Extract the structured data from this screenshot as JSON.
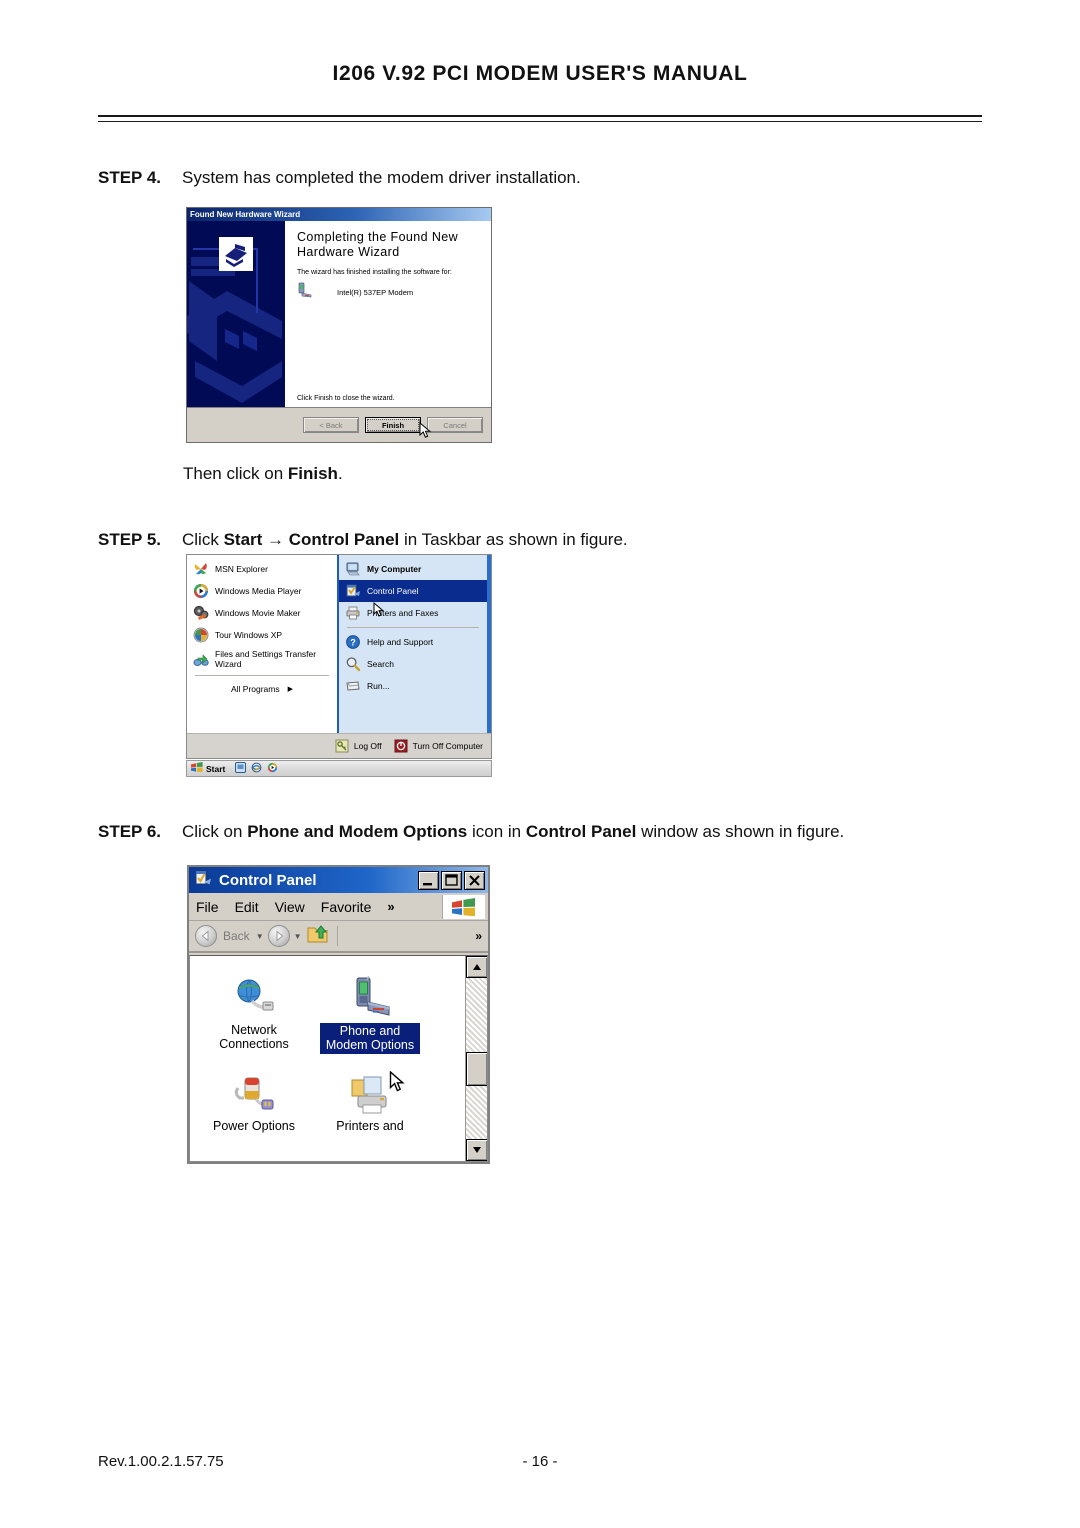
{
  "document": {
    "header_title": "I206 V.92 PCI MODEM USER'S MANUAL",
    "footer_revision": "Rev.1.00.2.1.57.75",
    "footer_page": "- 16 -"
  },
  "steps": {
    "step4": {
      "label": "STEP 4.",
      "text": "System has completed the modem driver installation."
    },
    "step4_note_prefix": "Then click on ",
    "step4_note_bold": "Finish",
    "step4_note_suffix": ".",
    "step5": {
      "label": "STEP 5.",
      "t1": "Click ",
      "b1": "Start",
      "t2": " ",
      "arrow": "→",
      "t3": " ",
      "b2": "Control Panel",
      "t4": " in Taskbar as shown in figure."
    },
    "step6": {
      "label": "STEP 6.",
      "t1": "Click on ",
      "b1": "Phone and Modem Options",
      "t2": " icon in ",
      "b2": "Control Panel",
      "t3": " window as shown in figure."
    }
  },
  "wizard": {
    "titlebar": "Found New Hardware Wizard",
    "heading_line1": "Completing the Found New",
    "heading_line2": "Hardware Wizard",
    "subtext": "The wizard has finished installing the software for:",
    "device_name": "Intel(R) 537EP Modem",
    "device_icon": "modem-icon",
    "sidebar_icon": "wizard-emblem-icon",
    "footer_text": "Click Finish to close the wizard.",
    "buttons": {
      "back": "< Back",
      "finish": "Finish",
      "cancel": "Cancel"
    },
    "cursor": "mouse-pointer-icon"
  },
  "startmenu": {
    "left_items": [
      {
        "label": "MSN Explorer",
        "icon": "msn-butterfly-icon"
      },
      {
        "label": "Windows Media Player",
        "icon": "media-player-icon"
      },
      {
        "label": "Windows Movie Maker",
        "icon": "movie-maker-icon"
      },
      {
        "label": "Tour Windows XP",
        "icon": "tour-windows-icon"
      },
      {
        "label": "Files and Settings Transfer Wizard",
        "icon": "transfer-wizard-icon"
      }
    ],
    "all_programs": "All Programs",
    "all_programs_arrow": "▶",
    "right_items": [
      {
        "label": "My Computer",
        "icon": "my-computer-icon",
        "selected": false,
        "bold": true
      },
      {
        "label": "Control Panel",
        "icon": "control-panel-icon",
        "selected": true,
        "bold": false
      },
      {
        "label": "Printers and Faxes",
        "icon": "printer-icon",
        "selected": false,
        "bold": false
      },
      {
        "label": "Help and Support",
        "icon": "help-question-icon",
        "selected": false,
        "bold": false
      },
      {
        "label": "Search",
        "icon": "search-magnifier-icon",
        "selected": false,
        "bold": false
      },
      {
        "label": "Run...",
        "icon": "run-icon",
        "selected": false,
        "bold": false
      }
    ],
    "log_off": "Log Off",
    "log_off_icon": "log-off-key-icon",
    "turn_off": "Turn Off Computer",
    "turn_off_icon": "power-icon",
    "taskbar": {
      "start_label": "Start",
      "start_icon": "windows-flag-icon",
      "quicklaunch": [
        "desktop-icon",
        "internet-explorer-icon",
        "media-player-icon"
      ]
    },
    "cursor": "mouse-pointer-icon"
  },
  "controlpanel": {
    "title": "Control Panel",
    "title_icon": "control-panel-icon",
    "window_buttons": {
      "minimize": "minimize-icon",
      "maximize": "maximize-icon",
      "close": "close-icon"
    },
    "menus": [
      "File",
      "Edit",
      "View",
      "Favorite"
    ],
    "menu_overflow": "»",
    "brand_icon": "windows-flag-icon",
    "toolbar": {
      "back_label": "Back",
      "back_icon": "back-arrow-icon",
      "forward_icon": "forward-arrow-icon",
      "up_icon": "up-folder-icon",
      "overflow": "»"
    },
    "icons": [
      {
        "label": "Network Connections",
        "icon": "network-connections-icon",
        "selected": false
      },
      {
        "label": "Phone and Modem Options",
        "icon": "phone-modem-icon",
        "selected": true
      },
      {
        "label": "Power Options",
        "icon": "power-options-icon",
        "selected": false
      },
      {
        "label": "Printers and",
        "icon": "printers-and-faxes-icon",
        "selected": false
      }
    ],
    "scrollbar": {
      "up_arrow": "▲",
      "down_arrow": "▼"
    },
    "cursor": "mouse-pointer-icon"
  },
  "colors": {
    "titlebar_blue_dark": "#0a246a",
    "titlebar_blue_light": "#a6caf0",
    "selection_blue": "#0a2c8e",
    "wizard_sidebar": "#000a55",
    "dialog_face": "#d4d0c8"
  }
}
